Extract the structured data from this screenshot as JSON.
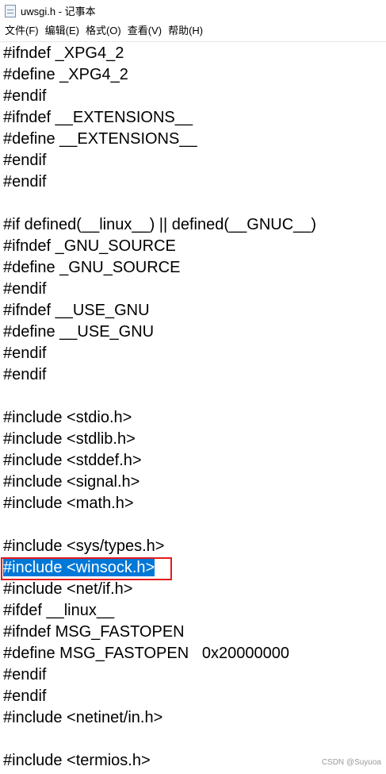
{
  "window": {
    "title": "uwsgi.h - 记事本",
    "icon": "notepad-icon"
  },
  "menu": [
    "文件(F)",
    "编辑(E)",
    "格式(O)",
    "查看(V)",
    "帮助(H)"
  ],
  "editor": {
    "lines": [
      "#ifndef _XPG4_2",
      "#define _XPG4_2",
      "#endif",
      "#ifndef __EXTENSIONS__",
      "#define __EXTENSIONS__",
      "#endif",
      "#endif",
      "",
      "#if defined(__linux__) || defined(__GNUC__)",
      "#ifndef _GNU_SOURCE",
      "#define _GNU_SOURCE",
      "#endif",
      "#ifndef __USE_GNU",
      "#define __USE_GNU",
      "#endif",
      "#endif",
      "",
      "#include <stdio.h>",
      "#include <stdlib.h>",
      "#include <stddef.h>",
      "#include <signal.h>",
      "#include <math.h>",
      "",
      "#include <sys/types.h>",
      "#include <winsock.h>",
      "#include <net/if.h>",
      "#ifdef __linux__",
      "#ifndef MSG_FASTOPEN",
      "#define MSG_FASTOPEN   0x20000000",
      "#endif",
      "#endif",
      "#include <netinet/in.h>",
      "",
      "#include <termios.h>"
    ],
    "selected_line_index": 24,
    "selection_color": "#0078d7",
    "highlight_color": "#e21b1b"
  },
  "watermark": "CSDN @Suyuoa"
}
